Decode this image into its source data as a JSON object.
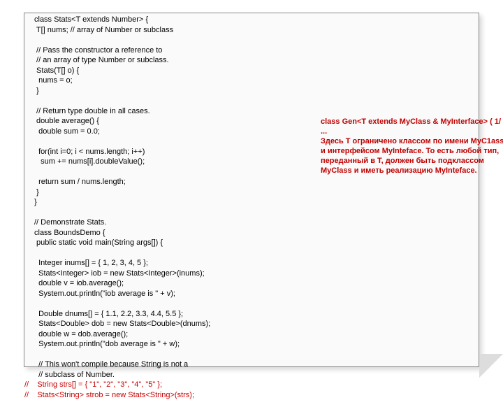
{
  "code": {
    "l01": "class Stats<T extends Number> {",
    "l02": " T[] nums; // array of Number or subclass",
    "l03": "",
    "l04": " // Pass the constructor a reference to",
    "l05": " // an array of type Number or subclass.",
    "l06": " Stats(T[] o) {",
    "l07": "  nums = o;",
    "l08": " }",
    "l09": "",
    "l10": " // Return type double in all cases.",
    "l11": " double average() {",
    "l12": "  double sum = 0.0;",
    "l13": "",
    "l14": "  for(int i=0; i < nums.length; i++)",
    "l15": "   sum += nums[i].doubleValue();",
    "l16": "",
    "l17": "  return sum / nums.length;",
    "l18": " }",
    "l19": "}",
    "l20": "",
    "l21": "// Demonstrate Stats.",
    "l22": "class BoundsDemo {",
    "l23": " public static void main(String args[]) {",
    "l24": "",
    "l25": "  Integer inums[] = { 1, 2, 3, 4, 5 };",
    "l26": "  Stats<Integer> iob = new Stats<Integer>(inums);",
    "l27": "  double v = iob.average();",
    "l28": "  System.out.println(\"iob average is \" + v);",
    "l29": "",
    "l30": "  Double dnums[] = { 1.1, 2.2, 3.3, 4.4, 5.5 };",
    "l31": "  Stats<Double> dob = new Stats<Double>(dnums);",
    "l32": "  double w = dob.average();",
    "l33": "  System.out.println(\"dob average is \" + w);",
    "l34": "",
    "l35": "  // This won't compile because String is not a",
    "l36": "  // subclass of Number.",
    "l37": "//    String strs[] = { \"1\", \"2\", \"3\", \"4\", \"5\" };",
    "l38": "//    Stats<String> strob = new Stats<String>(strs);"
  },
  "note": {
    "t1": "class Gen<T extends MyClass & MyInterface> ( 1/ ...",
    "t2": "Здесь T ограничено классом по имени МуС1аss и интерфейсом MyInteface. То есть любой тип, переданный в Т, должен быть подклассом MyClass и иметь реализацию MyInteface."
  }
}
